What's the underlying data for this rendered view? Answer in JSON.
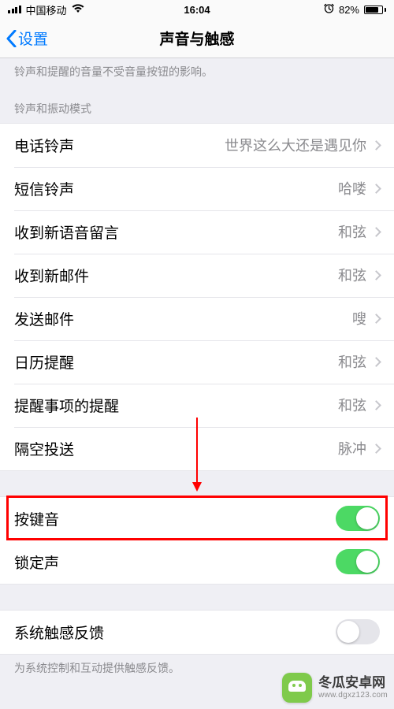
{
  "status": {
    "carrier": "中国移动",
    "time": "16:04",
    "battery_pct": "82%",
    "battery_fill_pct": 82
  },
  "nav": {
    "back_label": "设置",
    "title": "声音与触感"
  },
  "notes": {
    "ringer_note": "铃声和提醒的音量不受音量按钮的影响。"
  },
  "section_ring": {
    "header": "铃声和振动模式",
    "items": [
      {
        "label": "电话铃声",
        "value": "世界这么大还是遇见你"
      },
      {
        "label": "短信铃声",
        "value": "哈喽"
      },
      {
        "label": "收到新语音留言",
        "value": "和弦"
      },
      {
        "label": "收到新邮件",
        "value": "和弦"
      },
      {
        "label": "发送邮件",
        "value": "嗖"
      },
      {
        "label": "日历提醒",
        "value": "和弦"
      },
      {
        "label": "提醒事项的提醒",
        "value": "和弦"
      },
      {
        "label": "隔空投送",
        "value": "脉冲"
      }
    ]
  },
  "section_clicks": {
    "items": [
      {
        "label": "按键音",
        "on": true
      },
      {
        "label": "锁定声",
        "on": true
      }
    ]
  },
  "section_haptic": {
    "items": [
      {
        "label": "系统触感反馈",
        "on": false
      }
    ],
    "footer": "为系统控制和互动提供触感反馈。"
  },
  "watermark": {
    "title": "冬瓜安卓网",
    "sub": "www.dgxz123.com"
  },
  "annotation": {
    "highlight_row_index": 0
  }
}
